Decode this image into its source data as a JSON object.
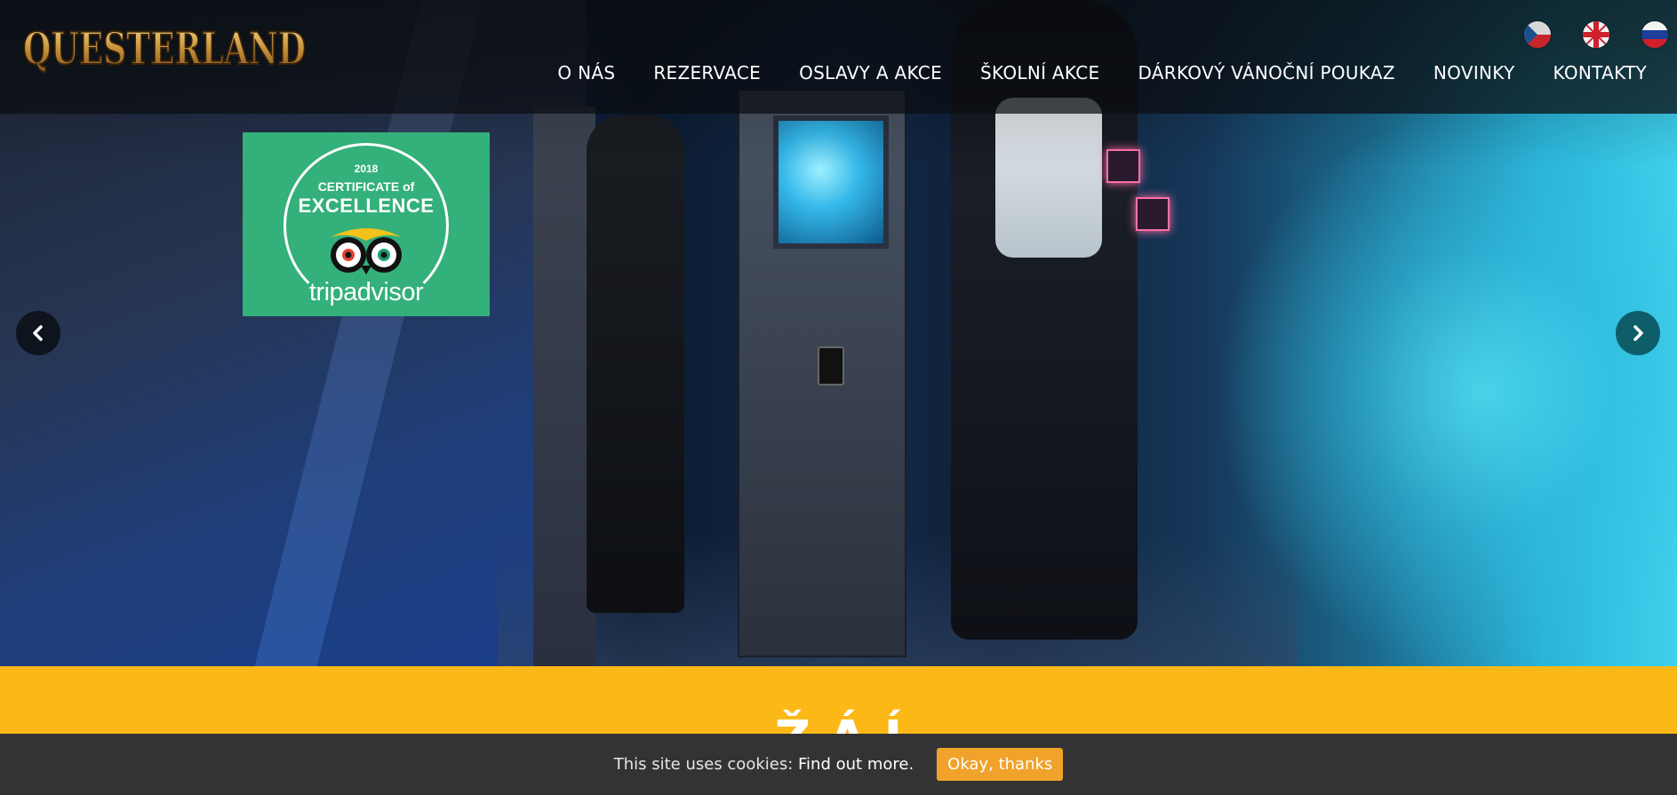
{
  "brand": {
    "logo_text": "QUESTERLAND"
  },
  "languages": [
    {
      "code": "cs",
      "icon": "czech-flag-icon"
    },
    {
      "code": "en",
      "icon": "uk-flag-icon"
    },
    {
      "code": "ru",
      "icon": "russian-flag-icon"
    }
  ],
  "nav": {
    "items": [
      {
        "label": "O NÁS"
      },
      {
        "label": "REZERVACE"
      },
      {
        "label": "OSLAVY A AKCE"
      },
      {
        "label": "ŠKOLNÍ AKCE"
      },
      {
        "label": "DÁRKOVÝ VÁNOČNÍ POUKAZ"
      },
      {
        "label": "NOVINKY"
      },
      {
        "label": "KONTAKTY"
      }
    ]
  },
  "badge": {
    "year": "2018",
    "line1": "CERTIFICATE of",
    "line2": "EXCELLENCE",
    "brand": "tripadvisor"
  },
  "carousel": {
    "prev_icon": "chevron-left-icon",
    "next_icon": "chevron-right-icon"
  },
  "section": {
    "heading_partial": "Ž Á Í"
  },
  "cookie": {
    "message": "This site uses cookies:",
    "link": "Find out more.",
    "button": "Okay, thanks"
  },
  "colors": {
    "accent_yellow": "#fbb817",
    "cookie_button": "#f0a22a",
    "badge_green": "#34b07a",
    "cookie_bar": "#333333"
  }
}
